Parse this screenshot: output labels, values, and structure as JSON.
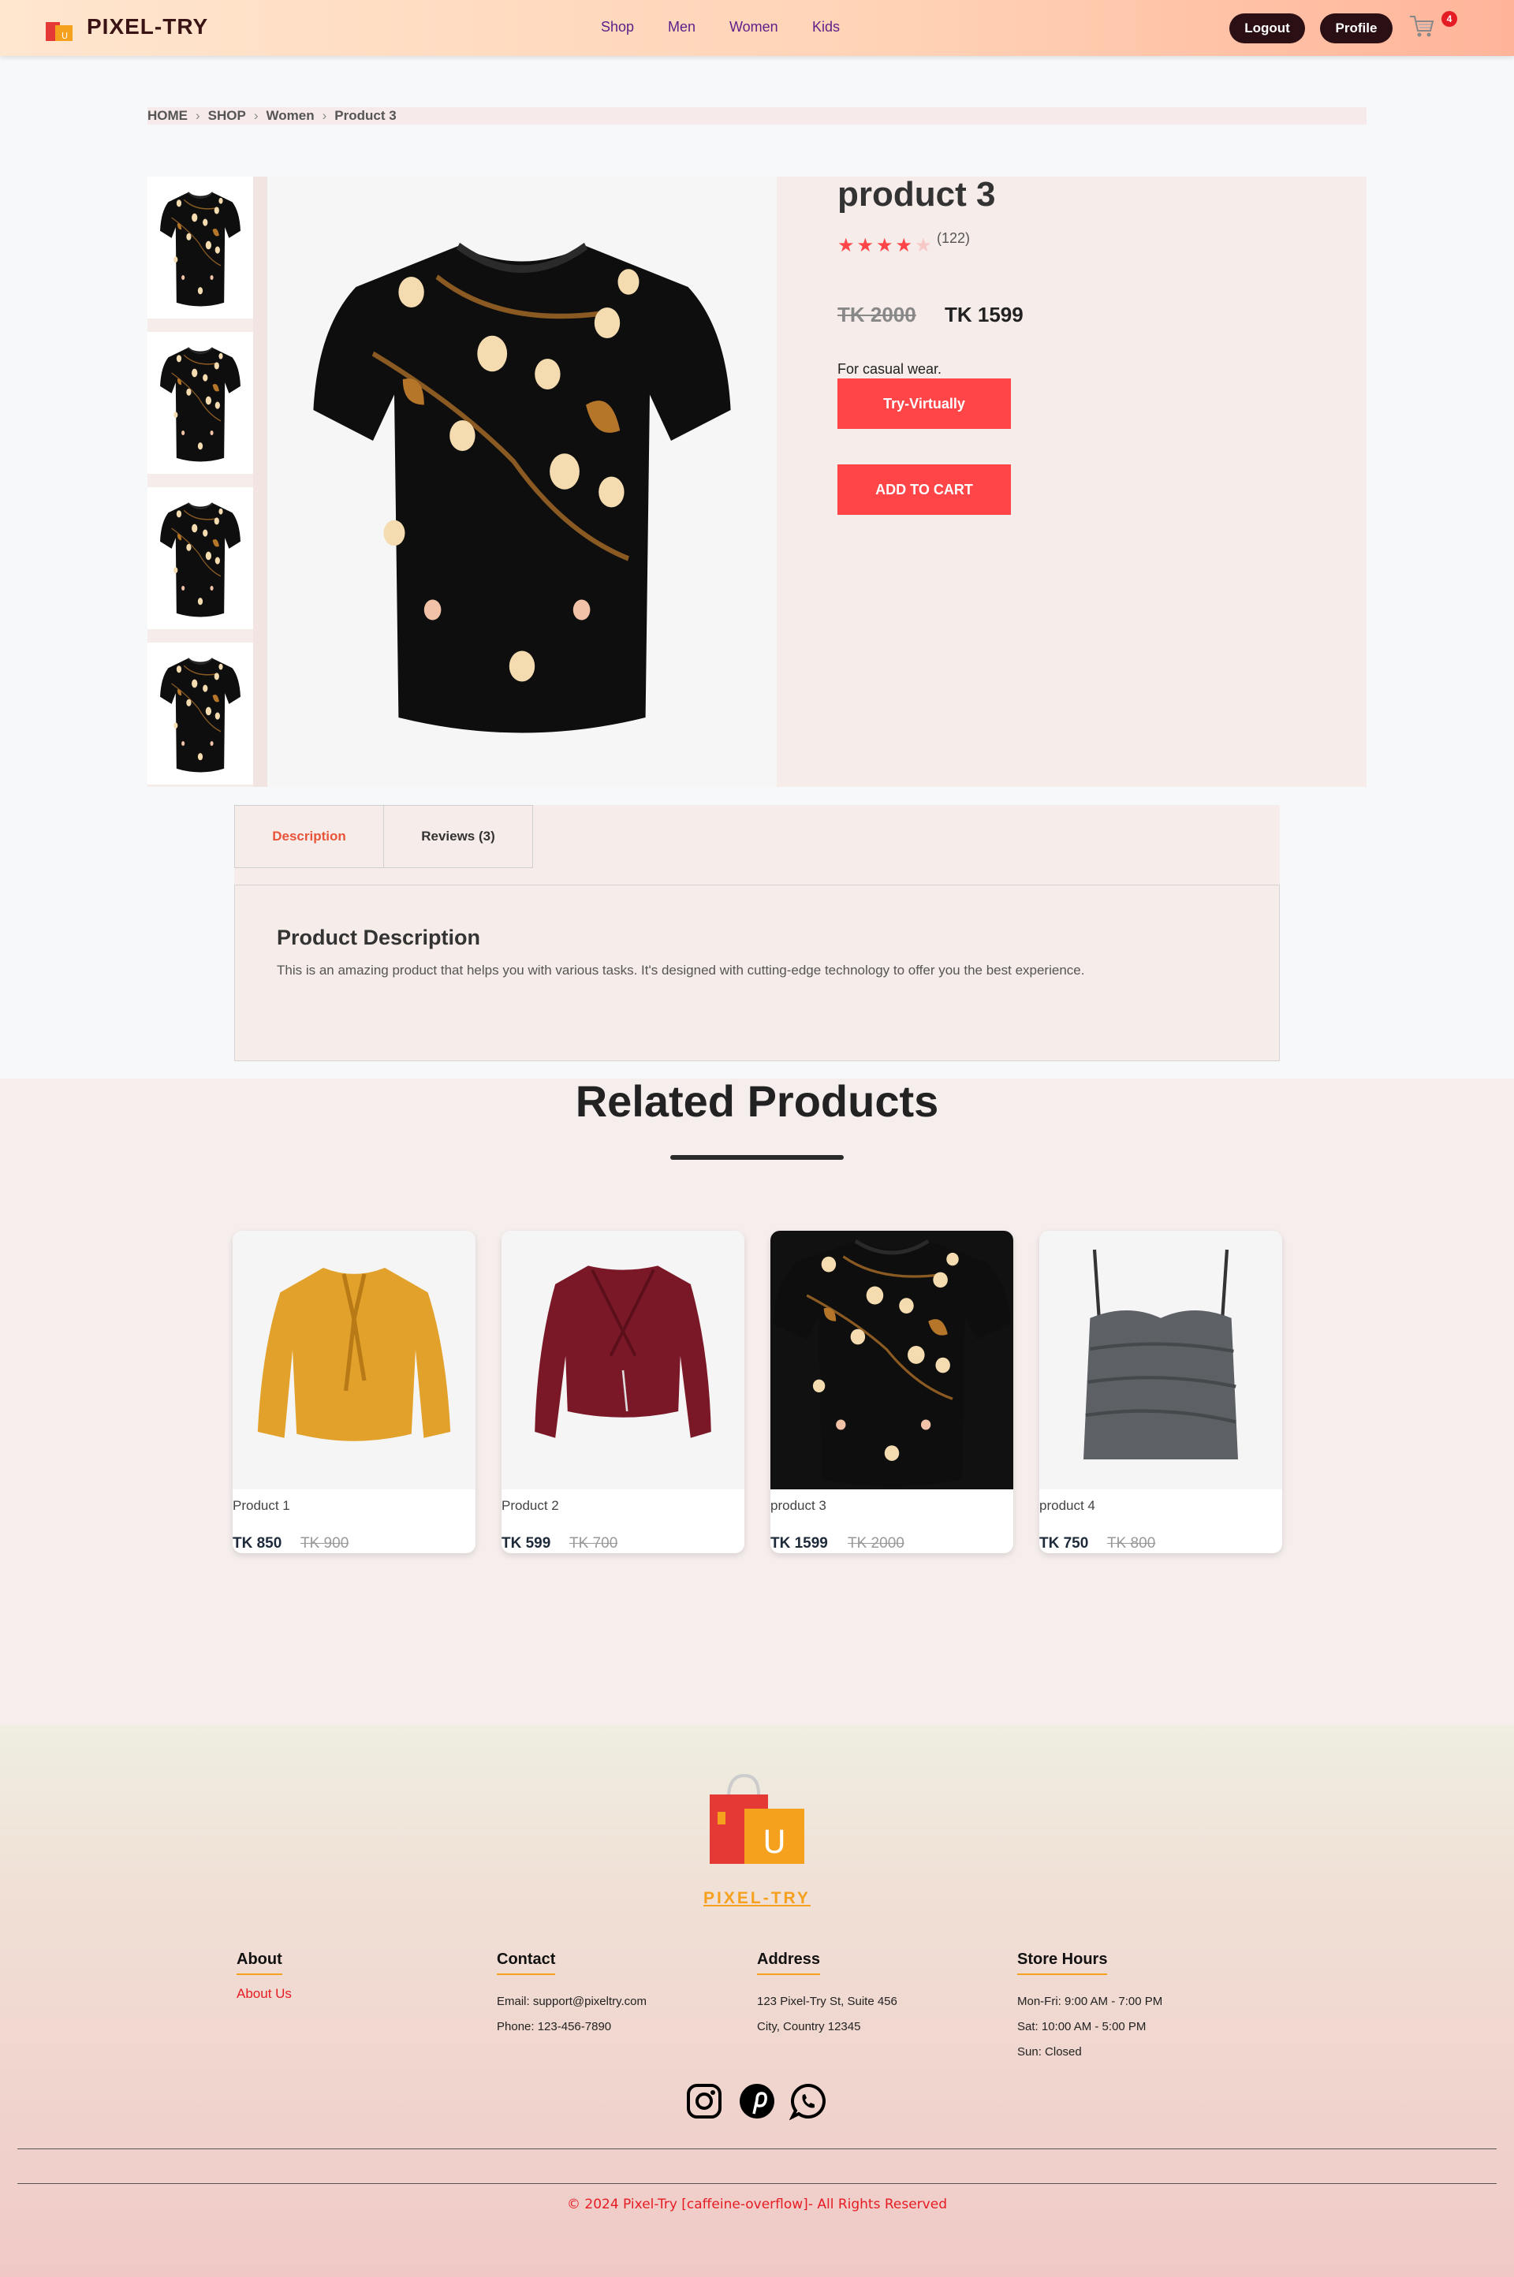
{
  "header": {
    "brand": "PIXEL-TRY",
    "nav": [
      "Shop",
      "Men",
      "Women",
      "Kids"
    ],
    "logout_label": "Logout",
    "profile_label": "Profile",
    "cart_count": "4"
  },
  "breadcrumb": [
    "HOME",
    "SHOP",
    "Women",
    "Product 3"
  ],
  "product": {
    "title": "product 3",
    "rating": 4,
    "rating_max": 5,
    "review_count": "(122)",
    "old_price": "TK 2000",
    "price": "TK 1599",
    "description": "For casual wear.",
    "try_label": "Try-Virtually",
    "cart_label": "ADD TO CART"
  },
  "tabs": {
    "description_label": "Description",
    "reviews_label": "Reviews (3)",
    "panel_title": "Product Description",
    "panel_text": "This is an amazing product that helps you with various tasks. It's designed with cutting-edge technology to offer you the best experience."
  },
  "related": {
    "heading": "Related Products",
    "items": [
      {
        "name": "Product 1",
        "price": "TK 850",
        "old_price": "TK 900"
      },
      {
        "name": "Product 2",
        "price": "TK 599",
        "old_price": "TK 700"
      },
      {
        "name": "product 3",
        "price": "TK 1599",
        "old_price": "TK 2000"
      },
      {
        "name": "product 4",
        "price": "TK 750",
        "old_price": "TK 800"
      }
    ]
  },
  "footer": {
    "brand": "PIXEL-TRY",
    "logo_letter": "U",
    "about": {
      "heading": "About",
      "link": "About Us"
    },
    "contact": {
      "heading": "Contact",
      "email": "Email: support@pixeltry.com",
      "phone": "Phone: 123-456-7890"
    },
    "address": {
      "heading": "Address",
      "line1": "123 Pixel-Try St, Suite 456",
      "line2": "City, Country 12345"
    },
    "hours": {
      "heading": "Store Hours",
      "line1": "Mon-Fri: 9:00 AM - 7:00 PM",
      "line2": "Sat: 10:00 AM - 5:00 PM",
      "line3": "Sun: Closed"
    },
    "social": [
      "instagram-icon",
      "pinterest-icon",
      "whatsapp-icon"
    ],
    "copyright": "© 2024 Pixel-Try [caffeine-overflow]- All Rights Reserved"
  },
  "colors": {
    "accent_red": "#ff4548",
    "dark": "#2a0f14",
    "footer_orange": "#f5a11d",
    "nav_purple": "#5b1f8a"
  }
}
